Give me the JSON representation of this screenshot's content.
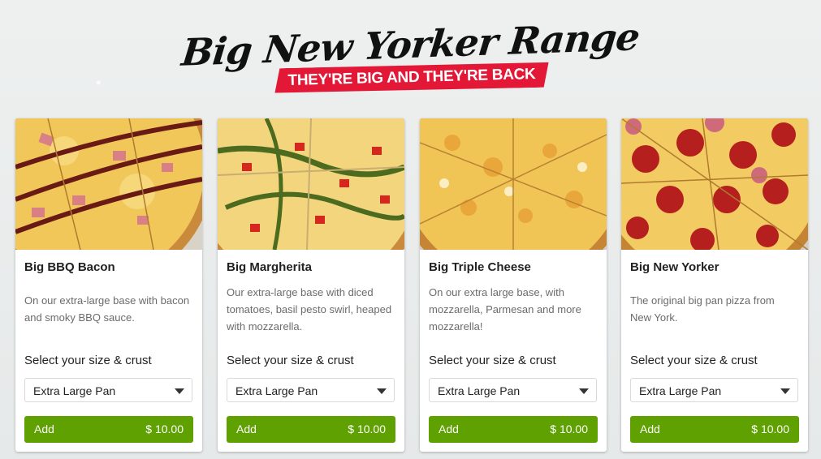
{
  "hero": {
    "title": "Big New Yorker Range",
    "subtitle": "THEY'RE BIG AND THEY'RE BACK"
  },
  "size_label": "Select your size & crust",
  "products": [
    {
      "name": "Big BBQ Bacon",
      "description": "On our extra-large base with bacon and smoky BBQ sauce.",
      "selected_option": "Extra Large Pan",
      "add_label": "Add",
      "price": "$ 10.00",
      "image": "bbq-bacon-pizza-image"
    },
    {
      "name": "Big Margherita",
      "description": "Our extra-large base with diced tomatoes, basil pesto swirl, heaped with mozzarella.",
      "selected_option": "Extra Large Pan",
      "add_label": "Add",
      "price": "$ 10.00",
      "image": "margherita-pizza-image"
    },
    {
      "name": "Big Triple Cheese",
      "description": "On our extra large base, with mozzarella, Parmesan and more mozzarella!",
      "selected_option": "Extra Large Pan",
      "add_label": "Add",
      "price": "$ 10.00",
      "image": "triple-cheese-pizza-image"
    },
    {
      "name": "Big New Yorker",
      "description": "The original big pan pizza from New York.",
      "selected_option": "Extra Large Pan",
      "add_label": "Add",
      "price": "$ 10.00",
      "image": "new-yorker-pizza-image"
    }
  ],
  "colors": {
    "accent_green": "#5ea100",
    "banner_red": "#e31837"
  }
}
